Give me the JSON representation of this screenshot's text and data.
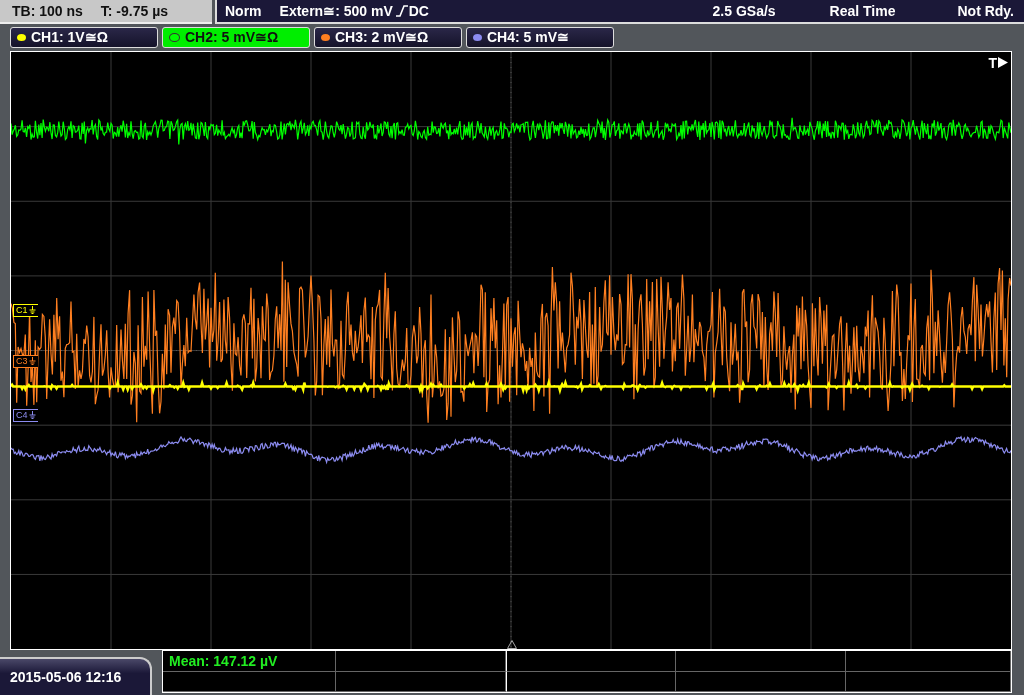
{
  "header": {
    "timebase": "TB: 100 ns",
    "trigger_time": "T: -9.75 µs",
    "trigger_mode": "Norm",
    "trigger_source": "Extern≅: 500 mV",
    "trigger_coupling": "DC",
    "sample_rate": "2.5 GSa/s",
    "acquisition": "Real Time",
    "status": "Not Rdy."
  },
  "channels": [
    {
      "label": "CH1: 1V≅Ω",
      "color": "#ffff00",
      "selected": false
    },
    {
      "label": "CH2: 5 mV≅Ω",
      "color": "#00ff00",
      "selected": true
    },
    {
      "label": "CH3: 2 mV≅Ω",
      "color": "#ff7f20",
      "selected": false
    },
    {
      "label": "CH4: 5 mV≅",
      "color": "#8c8cf0",
      "selected": false
    }
  ],
  "markers": [
    {
      "label": "C1",
      "color": "#ffff00"
    },
    {
      "label": "C3",
      "color": "#ff7f20"
    },
    {
      "label": "C4",
      "color": "#8c8cf0"
    }
  ],
  "trigger_marker": "T",
  "measurement": {
    "text": "Mean: 147.12 µV",
    "color": "#22ee22"
  },
  "date": "2015-05-06 12:16"
}
